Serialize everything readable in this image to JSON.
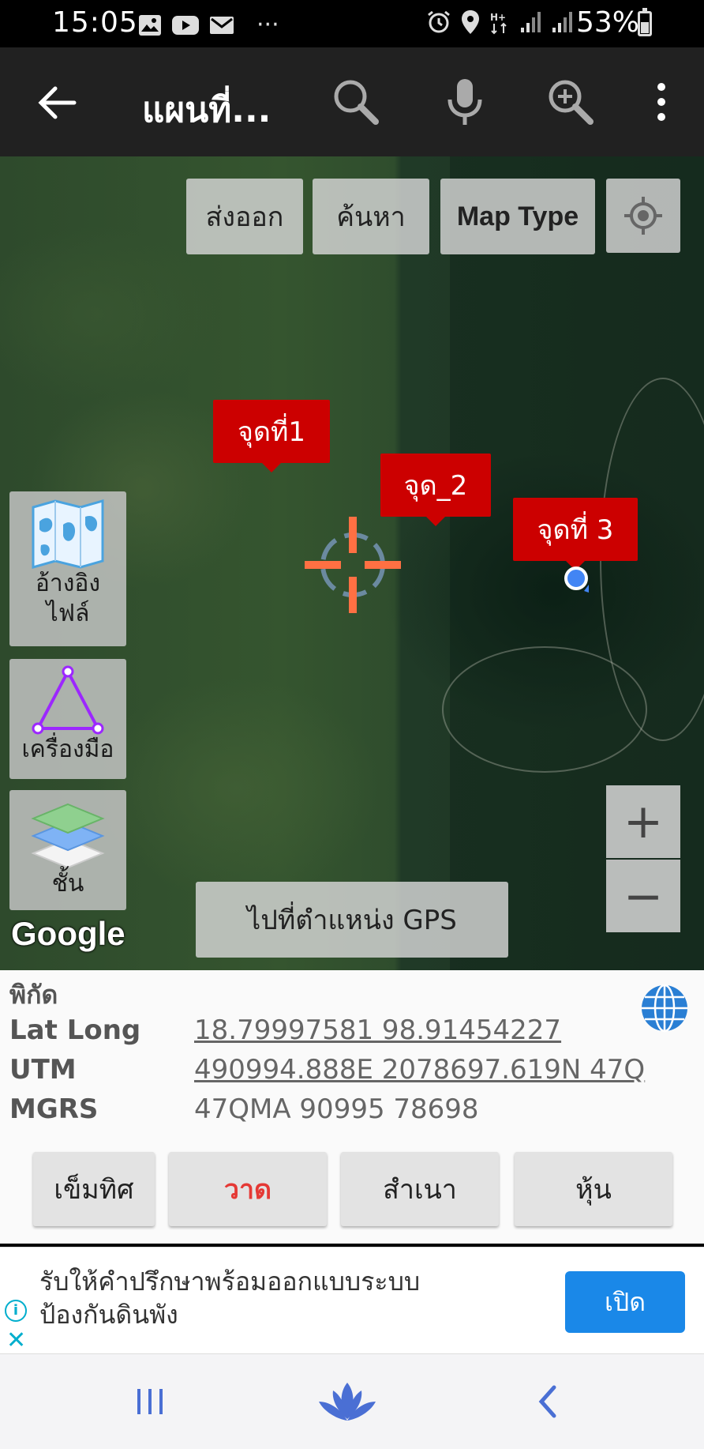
{
  "status_bar": {
    "time": "15:05",
    "more": "···",
    "battery": "53%"
  },
  "app_bar": {
    "title": "แผนที่..."
  },
  "map": {
    "export_label": "ส่งออก",
    "search_label": "ค้นหา",
    "map_type_label": "Map Type",
    "markers": [
      "จุดที่1",
      "จุด_2",
      "จุดที่ 3"
    ],
    "reference_file_label": "อ้างอิง\nไฟล์",
    "tools_label": "เครื่องมือ",
    "layers_label": "ชั้น",
    "goto_gps_label": "ไปที่ตำแหน่ง GPS",
    "zoom_in": "+",
    "zoom_out": "−",
    "attribution": "Google"
  },
  "coordinates": {
    "heading": "พิกัด",
    "rows": [
      {
        "label": "Lat Long",
        "value": "18.79997581 98.91454227"
      },
      {
        "label": "UTM",
        "value": "490994.888E 2078697.619N 47Q"
      },
      {
        "label": "MGRS",
        "value": "47QMA 90995 78698"
      }
    ]
  },
  "actions": {
    "compass": "เข็มทิศ",
    "draw": "วาด",
    "copy": "สำเนา",
    "stocks": "หุ้น"
  },
  "ad": {
    "text_line1": "รับให้คำปรึกษาพร้อมออกแบบระบบ",
    "text_line2": "ป้องกันดินพัง",
    "open_label": "เปิด"
  },
  "colors": {
    "marker": "#cc0000",
    "draw_text": "#e53935",
    "accent": "#1a88e8"
  }
}
